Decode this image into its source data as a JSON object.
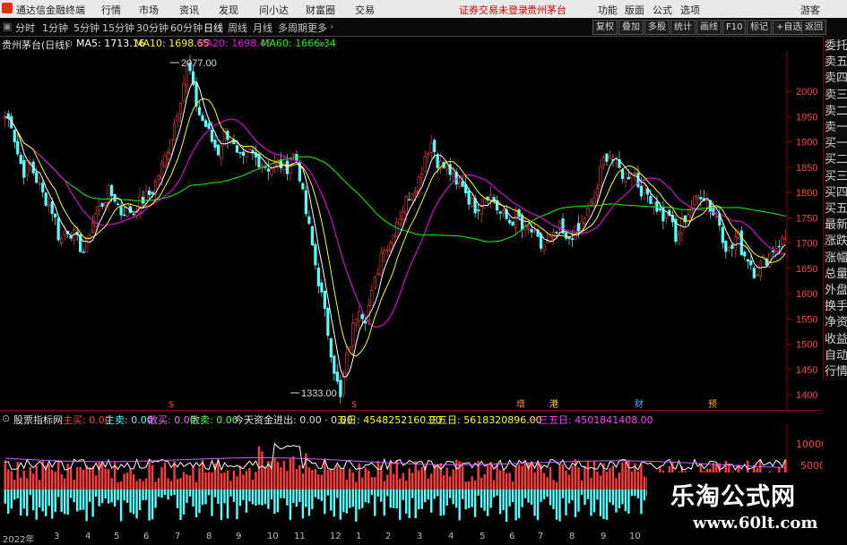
{
  "window": {
    "app_title": "通达信金融终端",
    "menus": [
      "行情",
      "市场",
      "资讯",
      "发现",
      "问小达",
      "财富圈",
      "交易"
    ],
    "warning": "证券交易未登录",
    "stock_title": "贵州茅台",
    "right_menus": [
      "功能",
      "版面",
      "公式",
      "选项"
    ],
    "guest": "游客"
  },
  "toolbar": {
    "periods": [
      "分时",
      "1分钟",
      "5分钟",
      "15分钟",
      "30分钟",
      "60分钟",
      "日线",
      "周线",
      "月线",
      "多周期",
      "更多"
    ],
    "active_period": "日线",
    "buttons": [
      "复权",
      "叠加",
      "多股",
      "统计",
      "画线",
      "F10",
      "标记",
      "+自选",
      "返回"
    ]
  },
  "main_legend": {
    "name": "贵州茅台(日线)",
    "ma5": "MA5: 1713.16",
    "ma10": "MA10: 1698.65",
    "ma20": "MA20: 1698.45",
    "ma60": "MA60: 1666.34"
  },
  "colors": {
    "ma5": "#ffffff",
    "ma10": "#ffff00",
    "ma20": "#ff00ff",
    "ma60": "#00ff00",
    "up": "#ff3c3c",
    "down": "#54ffff",
    "axis": "#8a0000"
  },
  "price_labels": {
    "high": "2077.00",
    "low": "1333.00"
  },
  "y_axis": [
    "2000",
    "1950",
    "1900",
    "1850",
    "1800",
    "1750",
    "1700",
    "1650",
    "1600",
    "1550",
    "1500",
    "1450",
    "1400"
  ],
  "event_markers": [
    "$",
    "$",
    "增",
    "港",
    "财",
    "预"
  ],
  "right_panel": [
    "委托",
    "卖五",
    "卖四",
    "卖三",
    "卖二",
    "卖一",
    "买一",
    "买二",
    "买三",
    "买四",
    "买五",
    "最新",
    "涨跌",
    "涨幅",
    "总量",
    "外盘",
    "换手",
    "净资",
    "收益",
    "自动",
    "行情"
  ],
  "indicator_legend": {
    "name": "股票指标网",
    "buy_lg": "主买: 0.00",
    "sell_lg": "主卖: 0.00",
    "buy_sm": "散买: 0.00",
    "sell_sm": "散卖: 0.00",
    "today_flow": "今天资金进出: 0.00 · 0.00",
    "d5": "五日: 4548252160.00",
    "d35": "三五日: 5618320896.00",
    "d35n": "一三五日: 4501841408.00"
  },
  "indicator_y": [
    "10000",
    "5000"
  ],
  "x_axis": [
    "2022年",
    "3",
    "4",
    "5",
    "6",
    "7",
    "8",
    "9",
    "10",
    "11",
    "12",
    "1",
    "2",
    "3",
    "4",
    "5",
    "6",
    "7",
    "8",
    "9",
    "10"
  ],
  "watermark": {
    "cn": "乐淘公式网",
    "url": "www.60lt.com"
  },
  "chart_data": {
    "type": "candlestick",
    "ylim": [
      1370,
      2080
    ],
    "price_high": 2077.0,
    "price_low": 1333.0,
    "close_series_approx": [
      1950,
      1940,
      1880,
      1840,
      1860,
      1830,
      1800,
      1780,
      1760,
      1700,
      1730,
      1720,
      1700,
      1680,
      1730,
      1760,
      1780,
      1800,
      1790,
      1760,
      1770,
      1760,
      1780,
      1790,
      1800,
      1830,
      1860,
      1900,
      1950,
      2000,
      2060,
      1990,
      1950,
      1930,
      1900,
      1880,
      1920,
      1910,
      1870,
      1860,
      1880,
      1870,
      1860,
      1850,
      1850,
      1860,
      1840,
      1880,
      1860,
      1780,
      1720,
      1650,
      1590,
      1520,
      1450,
      1390,
      1470,
      1530,
      1580,
      1550,
      1590,
      1640,
      1700,
      1690,
      1740,
      1760,
      1790,
      1810,
      1830,
      1880,
      1900,
      1860,
      1850,
      1840,
      1810,
      1820,
      1790,
      1770,
      1780,
      1800,
      1790,
      1760,
      1750,
      1740,
      1760,
      1720,
      1730,
      1710,
      1690,
      1700,
      1710,
      1730,
      1700,
      1720,
      1720,
      1750,
      1770,
      1800,
      1860,
      1880,
      1860,
      1840,
      1830,
      1850,
      1810,
      1800,
      1790,
      1770,
      1750,
      1760,
      1700,
      1740,
      1760,
      1780,
      1800,
      1790,
      1760,
      1750,
      1700,
      1680,
      1720,
      1680,
      1670,
      1640,
      1660,
      1670,
      1690,
      1700,
      1710
    ]
  }
}
